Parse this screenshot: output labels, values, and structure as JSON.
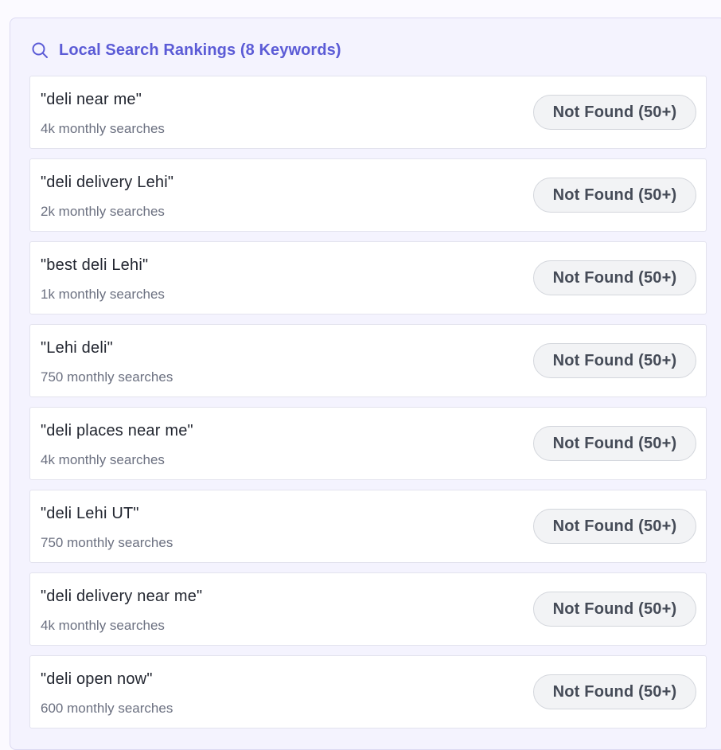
{
  "panel": {
    "title": "Local Search Rankings (8 Keywords)",
    "icon": "search-icon",
    "accent_color": "#5b5bd6"
  },
  "keywords": [
    {
      "term": "\"deli near me\"",
      "volume": "4k monthly searches",
      "status": "Not Found (50+)"
    },
    {
      "term": "\"deli delivery Lehi\"",
      "volume": "2k monthly searches",
      "status": "Not Found (50+)"
    },
    {
      "term": "\"best deli Lehi\"",
      "volume": "1k monthly searches",
      "status": "Not Found (50+)"
    },
    {
      "term": "\"Lehi deli\"",
      "volume": "750 monthly searches",
      "status": "Not Found (50+)"
    },
    {
      "term": "\"deli places near me\"",
      "volume": "4k monthly searches",
      "status": "Not Found (50+)"
    },
    {
      "term": "\"deli Lehi UT\"",
      "volume": "750 monthly searches",
      "status": "Not Found (50+)"
    },
    {
      "term": "\"deli delivery near me\"",
      "volume": "4k monthly searches",
      "status": "Not Found (50+)"
    },
    {
      "term": "\"deli open now\"",
      "volume": "600 monthly searches",
      "status": "Not Found (50+)"
    }
  ]
}
